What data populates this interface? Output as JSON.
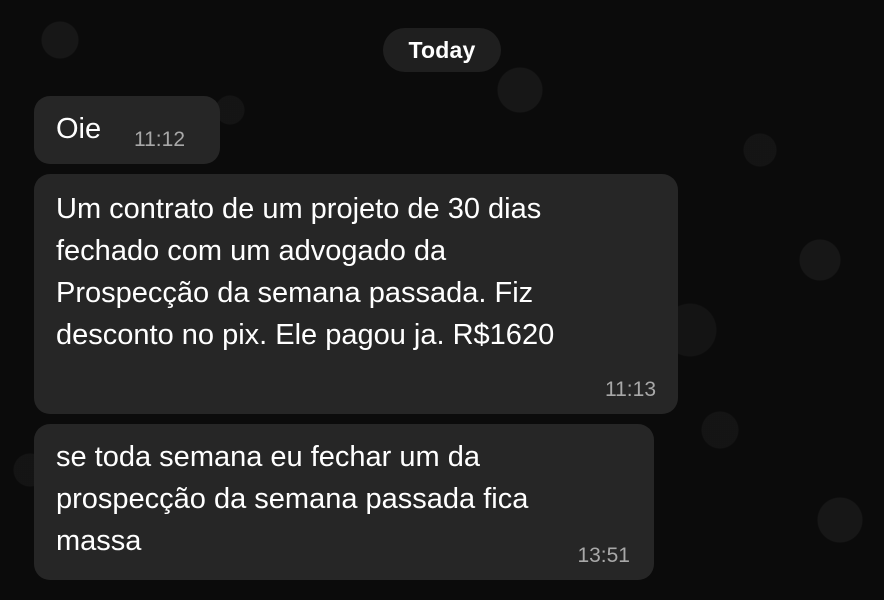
{
  "chat": {
    "day_separator": "Today",
    "messages": [
      {
        "text": "Oie",
        "time": "11:12"
      },
      {
        "text": "Um contrato de um projeto de 30 dias\nfechado com um advogado da\nProspecção da semana passada. Fiz\ndesconto no pix. Ele pagou ja. R$1620",
        "time": "11:13"
      },
      {
        "text": "se toda semana eu fechar um da\nprospecção da semana passada fica\nmassa",
        "time": "13:51"
      }
    ]
  },
  "colors": {
    "background": "#0b0b0b",
    "bubble": "#262626",
    "text": "#ffffff",
    "timestamp": "#a8a8a8"
  }
}
